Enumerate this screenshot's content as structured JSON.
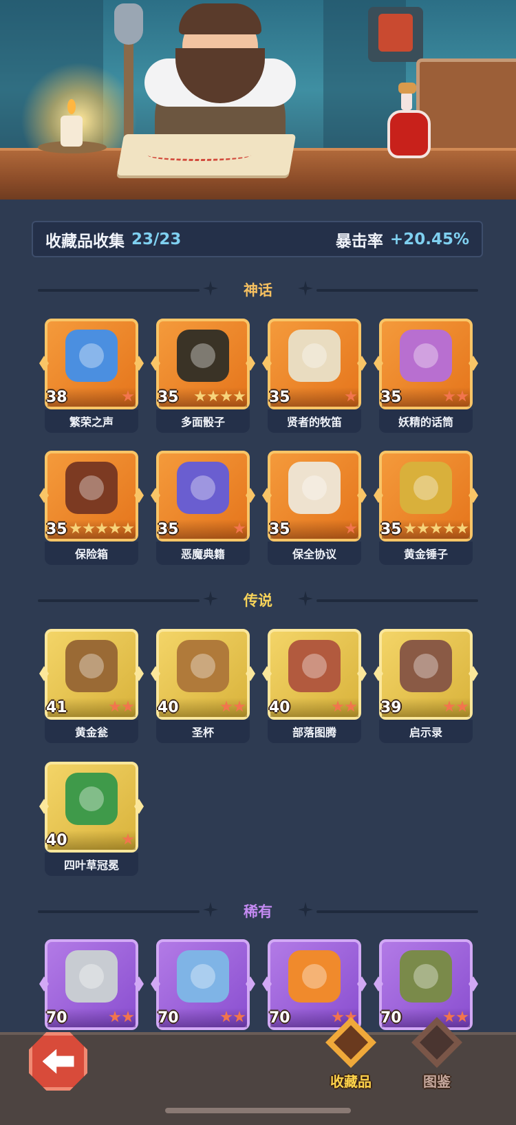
{
  "header": {
    "collection_label": "收藏品收集",
    "collection_count": "23/23",
    "stat_label": "暴击率",
    "stat_value": "+20.45%"
  },
  "sections": [
    {
      "title": "神话",
      "color": "#f6c060",
      "tier": "mythic"
    },
    {
      "title": "传说",
      "color": "#f6d35a",
      "tier": "legend"
    },
    {
      "title": "稀有",
      "color": "#c48af2",
      "tier": "rare"
    }
  ],
  "mythic_items": [
    {
      "name": "繁荣之声",
      "level": "38",
      "stars": 1,
      "star_color": "red",
      "art": "blue-wisp-icon",
      "art_color": "#4b8fe0"
    },
    {
      "name": "多面骰子",
      "level": "35",
      "stars": 4,
      "star_color": "gold",
      "art": "d20-dice-icon",
      "art_color": "#3a3326"
    },
    {
      "name": "贤者的牧笛",
      "level": "35",
      "stars": 1,
      "star_color": "red",
      "art": "pan-flute-icon",
      "art_color": "#e9dcc0"
    },
    {
      "name": "妖精的话筒",
      "level": "35",
      "stars": 2,
      "star_color": "red",
      "art": "fairy-microphone-icon",
      "art_color": "#b86fd0"
    },
    {
      "name": "保险箱",
      "level": "35",
      "stars": 5,
      "star_color": "gold",
      "art": "gold-chest-icon",
      "art_color": "#7c3a22"
    },
    {
      "name": "恶魔典籍",
      "level": "35",
      "stars": 1,
      "star_color": "red",
      "art": "demon-book-icon",
      "art_color": "#6a5ed0"
    },
    {
      "name": "保全协议",
      "level": "35",
      "stars": 1,
      "star_color": "red",
      "art": "contract-scroll-icon",
      "art_color": "#eee2cf"
    },
    {
      "name": "黄金锤子",
      "level": "35",
      "stars": 5,
      "star_color": "gold",
      "art": "golden-hammer-icon",
      "art_color": "#d9b03b"
    }
  ],
  "legend_items": [
    {
      "name": "黄金瓮",
      "level": "41",
      "stars": 2,
      "star_color": "red",
      "art": "golden-urn-icon",
      "art_color": "#9a6a35"
    },
    {
      "name": "圣杯",
      "level": "40",
      "stars": 2,
      "star_color": "red",
      "art": "holy-grail-icon",
      "art_color": "#b07a3a"
    },
    {
      "name": "部落图腾",
      "level": "40",
      "stars": 2,
      "star_color": "red",
      "art": "tribal-totem-icon",
      "art_color": "#b25a3e"
    },
    {
      "name": "启示录",
      "level": "39",
      "stars": 2,
      "star_color": "red",
      "art": "revelation-book-icon",
      "art_color": "#8a5a45"
    },
    {
      "name": "四叶草冠冕",
      "level": "40",
      "stars": 1,
      "star_color": "red",
      "art": "clover-crown-icon",
      "art_color": "#3f9a4a"
    }
  ],
  "rare_items": [
    {
      "name": "",
      "level": "70",
      "stars": 2,
      "star_color": "red",
      "art": "battle-axe-icon",
      "art_color": "#c8ccd2"
    },
    {
      "name": "",
      "level": "70",
      "stars": 2,
      "star_color": "red",
      "art": "frost-sword-icon",
      "art_color": "#7fb4e6"
    },
    {
      "name": "",
      "level": "70",
      "stars": 2,
      "star_color": "red",
      "art": "phoenix-feather-icon",
      "art_color": "#f08a2c"
    },
    {
      "name": "",
      "level": "70",
      "stars": 2,
      "star_color": "red",
      "art": "thorn-vine-icon",
      "art_color": "#7a8a4a"
    }
  ],
  "nav": {
    "back": "back-arrow-icon",
    "tabs": [
      {
        "label": "收藏品",
        "active": true,
        "icon": "collection-altar-icon"
      },
      {
        "label": "图鉴",
        "active": false,
        "icon": "codex-book-icon"
      }
    ]
  }
}
